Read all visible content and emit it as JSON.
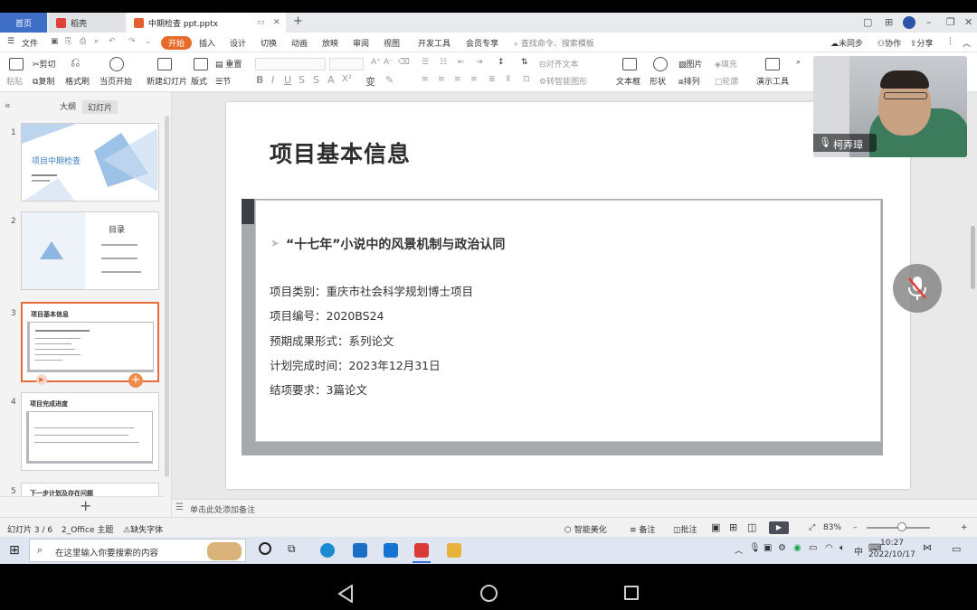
{
  "window": {
    "tabs": [
      {
        "label": "首页"
      },
      {
        "label": "稻壳"
      },
      {
        "label": "中期检查 ppt.pptx"
      }
    ]
  },
  "menu": {
    "file": "文件",
    "items": [
      "开始",
      "插入",
      "设计",
      "切换",
      "动画",
      "放映",
      "审阅",
      "视图",
      "开发工具",
      "会员专享"
    ],
    "search": "查找命令、搜索模板",
    "sync": "未同步",
    "collab": "协作",
    "share": "分享"
  },
  "ribbon": {
    "paste": "粘贴",
    "cut": "剪切",
    "copy": "复制",
    "format_painter": "格式刷",
    "from_current": "当页开始",
    "new_slide": "新建幻灯片",
    "layout": "版式",
    "section": "节",
    "reset": "重置",
    "align_text": "对齐文本",
    "convert_smartart": "转智能图形",
    "textbox": "文本框",
    "shape": "形状",
    "picture": "图片",
    "fill": "填充",
    "arrange": "排列",
    "outline": "轮廓",
    "presenter": "演示工具"
  },
  "leftpanel": {
    "tab_outline": "大纲",
    "tab_slides": "幻灯片",
    "thumbs": [
      {
        "num": "1",
        "title": "项目中期检查"
      },
      {
        "num": "2",
        "title": "目录"
      },
      {
        "num": "3",
        "title": "项目基本信息"
      },
      {
        "num": "4",
        "title": "项目完成进度"
      },
      {
        "num": "5",
        "title": "下一步计划及存在问题"
      }
    ]
  },
  "slide": {
    "title": "项目基本信息",
    "subtitle": "“十七年”小说中的风景机制与政治认同",
    "lines": [
      "项目类别：重庆市社会科学规划博士项目",
      "项目编号：2020BS24",
      "预期成果形式：系列论文",
      "计划完成时间：2023年12月31日",
      "结项要求：3篇论文"
    ]
  },
  "notes": {
    "placeholder": "单击此处添加备注"
  },
  "status": {
    "slide_count": "幻灯片 3 / 6",
    "theme": "2_Office 主题",
    "missing_font": "缺失字体",
    "beautify": "智能美化",
    "notes": "备注",
    "comment": "批注",
    "zoom": "83%",
    "zoom_fraction": 0.55
  },
  "taskbar": {
    "search_placeholder": "在这里输入你要搜索的内容",
    "time": "10:27",
    "date": "2022/10/17",
    "ime": "中"
  },
  "webcam": {
    "name": "柯弄璋"
  }
}
